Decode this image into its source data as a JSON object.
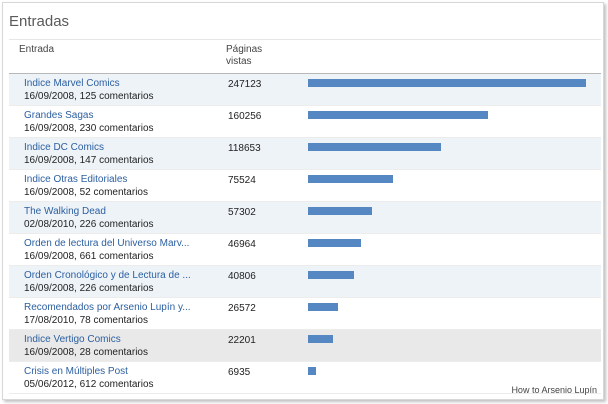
{
  "panel": {
    "title": "Entradas",
    "col_entrada": "Entrada",
    "col_views_line1": "Páginas",
    "col_views_line2": "vistas",
    "bar_color": "#5587c2",
    "max_views": 247123
  },
  "rows": [
    {
      "title": "Indice Marvel Comics",
      "meta": "16/09/2008, 125 comentarios",
      "views": 247123
    },
    {
      "title": "Grandes Sagas",
      "meta": "16/09/2008, 230 comentarios",
      "views": 160256
    },
    {
      "title": "Indice DC Comics",
      "meta": "16/09/2008, 147 comentarios",
      "views": 118653
    },
    {
      "title": "Indice Otras Editoriales",
      "meta": "16/09/2008, 52 comentarios",
      "views": 75524
    },
    {
      "title": "The Walking Dead",
      "meta": "02/08/2010, 226 comentarios",
      "views": 57302
    },
    {
      "title": "Orden de lectura del Universo Marv...",
      "meta": "16/09/2008, 661 comentarios",
      "views": 46964
    },
    {
      "title": "Orden Cronológico y de Lectura de ...",
      "meta": "16/09/2008, 226 comentarios",
      "views": 40806
    },
    {
      "title": "Recomendados por Arsenio Lupín y...",
      "meta": "17/08/2010, 78 comentarios",
      "views": 26572
    },
    {
      "title": "Indice Vertigo Comics",
      "meta": "16/09/2008, 28 comentarios",
      "views": 22201
    },
    {
      "title": "Crisis en Múltiples Post",
      "meta": "05/06/2012, 612 comentarios",
      "views": 6935
    }
  ],
  "watermark": "How to Arsenio Lupín"
}
